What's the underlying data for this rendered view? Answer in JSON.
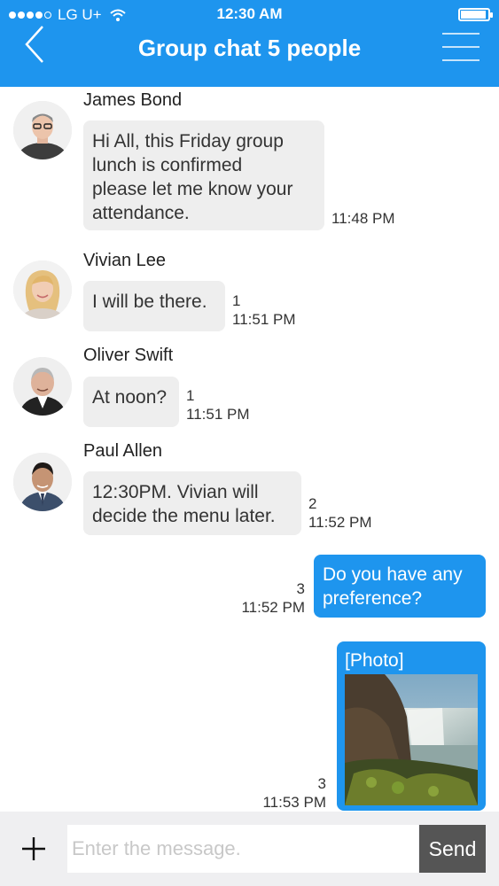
{
  "status_bar": {
    "carrier": "LG U+",
    "time": "12:30 AM",
    "signal_icon": "signal-dots-icon",
    "wifi_icon": "wifi-icon",
    "battery_icon": "battery-icon"
  },
  "header": {
    "title": "Group chat 5 people",
    "back_icon": "chevron-left-icon",
    "menu_icon": "menu-icon",
    "background_color": "#1e95ee"
  },
  "messages": [
    {
      "sender": "James Bond",
      "text_lines": [
        "Hi All, this Friday group",
        "lunch is confirmed",
        "please let me know your",
        "attendance."
      ],
      "unread": "",
      "time": "11:48 PM"
    },
    {
      "sender": "Vivian Lee",
      "text_lines": [
        "I will be there."
      ],
      "unread": "1",
      "time": "11:51 PM"
    },
    {
      "sender": "Oliver Swift",
      "text_lines": [
        "At noon?"
      ],
      "unread": "1",
      "time": "11:51 PM"
    },
    {
      "sender": "Paul Allen",
      "text_lines": [
        "12:30PM. Vivian will",
        "decide the menu later."
      ],
      "unread": "2",
      "time": "11:52 PM"
    },
    {
      "sender": "",
      "outgoing": true,
      "text_lines": [
        "Do you have any",
        "preference?"
      ],
      "unread": "3",
      "time": "11:52 PM"
    },
    {
      "sender": "",
      "outgoing": true,
      "photo_label": "[Photo]",
      "unread": "3",
      "time": "11:53 PM"
    }
  ],
  "input_bar": {
    "add_icon": "plus-icon",
    "placeholder": "Enter the message.",
    "value": "",
    "send_label": "Send"
  }
}
